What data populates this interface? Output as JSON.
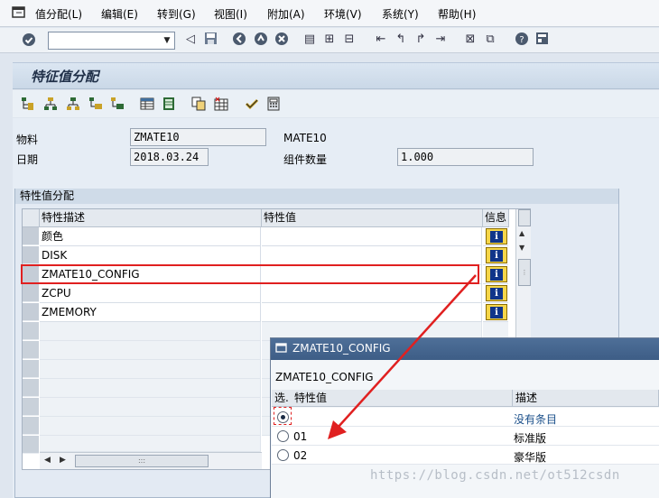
{
  "menubar": {
    "system_icon": "window-menu-icon",
    "items": [
      {
        "label": "值分配(L)"
      },
      {
        "label": "编辑(E)"
      },
      {
        "label": "转到(G)"
      },
      {
        "label": "视图(I)"
      },
      {
        "label": "附加(A)"
      },
      {
        "label": "环境(V)"
      },
      {
        "label": "系统(Y)"
      },
      {
        "label": "帮助(H)"
      }
    ]
  },
  "toolbar": {
    "command_field": {
      "value": "",
      "placeholder": ""
    },
    "icons": [
      "enter-icon",
      "back-icon",
      "save-icon",
      "exit-icon",
      "cancel-icon",
      "print-icon",
      "find-icon",
      "find-next-icon",
      "first-page-icon",
      "previous-page-icon",
      "next-page-icon",
      "last-page-icon",
      "new-session-icon",
      "shortcut-icon",
      "help-icon",
      "layout-icon"
    ]
  },
  "page": {
    "title": "特征值分配"
  },
  "app_toolbar": {
    "icons": [
      "hierarchy-icon",
      "tree-icon",
      "structure-icon",
      "tree-expand-icon",
      "tree-collapse-icon",
      "table-icon",
      "table-settings-icon",
      "copy-icon",
      "delete-values-icon",
      "check-icon",
      "calculator-icon"
    ]
  },
  "header": {
    "material_label": "物料",
    "material_value": "ZMATE10",
    "material_desc": "MATE10",
    "date_label": "日期",
    "date_value": "2018.03.24",
    "quantity_label": "组件数量",
    "quantity_value": "1.000"
  },
  "characteristics": {
    "group_title": "特性值分配",
    "columns": {
      "desc": "特性描述",
      "value": "特性值",
      "info": "信息"
    },
    "rows": [
      {
        "desc": "颜色",
        "value": ""
      },
      {
        "desc": "DISK",
        "value": ""
      },
      {
        "desc": "ZMATE10_CONFIG",
        "value": ""
      },
      {
        "desc": "ZCPU",
        "value": ""
      },
      {
        "desc": "ZMEMORY",
        "value": ""
      }
    ]
  },
  "popup": {
    "title": "ZMATE10_CONFIG",
    "subtitle": "ZMATE10_CONFIG",
    "columns": {
      "select": "选.",
      "value": "特性值",
      "desc": "描述"
    },
    "rows": [
      {
        "value": "",
        "desc": "没有条目",
        "selected": true
      },
      {
        "value": "01",
        "desc": "标准版",
        "selected": false
      },
      {
        "value": "02",
        "desc": "豪华版",
        "selected": false
      }
    ]
  },
  "watermark": "https://blog.csdn.net/ot512csdn",
  "colors": {
    "annotation": "#e02020",
    "popup_title_bg": "#3d5d86",
    "info_button": "#f5d64a"
  }
}
